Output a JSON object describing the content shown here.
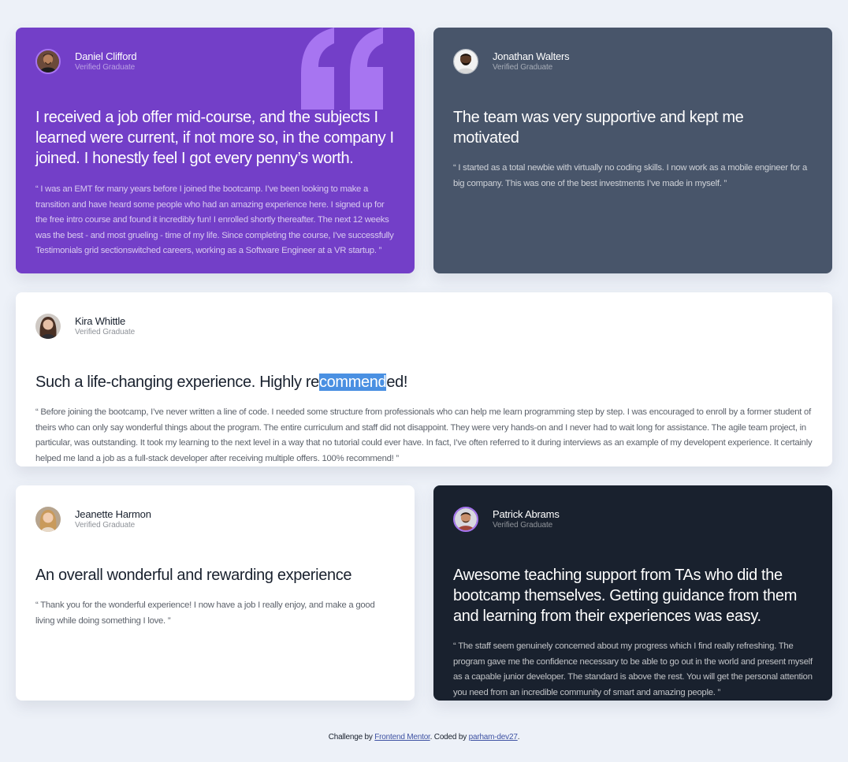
{
  "colors": {
    "page_background": "#edf1f8",
    "purple": "#733fc8",
    "grayish_blue": "#48556a",
    "white": "#ffffff",
    "dark_blackish_blue": "#19212e",
    "quote_mark": "#a775f1",
    "selection": "#4a90e2",
    "link": "#3e52a3"
  },
  "testimonials": {
    "daniel": {
      "name": "Daniel Clifford",
      "status": "Verified Graduate",
      "headline": "I received a job offer mid-course, and the subjects I learned were current, if not more so, in the company I joined. I honestly feel I got every penny’s worth.",
      "body": "“ I was an EMT for many years before I joined the bootcamp. I’ve been looking to make a transition and have heard some people who had an amazing experience here. I signed up for the free intro course and found it incredibly fun! I enrolled shortly thereafter. The next 12 weeks was the best - and most grueling - time of my life. Since completing the course, I’ve successfully Testimonials grid sectionswitched careers, working as a Software Engineer at a VR startup. ”",
      "icon": "quote-icon"
    },
    "jonathan": {
      "name": "Jonathan Walters",
      "status": "Verified Graduate",
      "headline": "The team was very supportive and kept me motivated",
      "body": "“ I started as a total newbie with virtually no coding skills. I now work as a mobile engineer for a big company. This was one of the best investments I’ve made in myself. ”"
    },
    "kira": {
      "name": "Kira Whittle",
      "status": "Verified Graduate",
      "headline_before": "Such a life-changing experience. Highly re",
      "headline_selected": "commend",
      "headline_after": "ed!",
      "body": "“ Before joining the bootcamp, I’ve never written a line of code. I needed some structure from professionals who can help me learn programming step by step. I was encouraged to enroll by a former student of theirs who can only say wonderful things about the program. The entire curriculum and staff did not disappoint. They were very hands-on and I never had to wait long for assistance. The agile team project, in particular, was outstanding. It took my learning to the next level in a way that no tutorial could ever have. In fact, I’ve often referred to it during interviews as an example of my developent experience. It certainly helped me land a job as a full-stack developer after receiving multiple offers. 100% recommend! ”"
    },
    "jeanette": {
      "name": "Jeanette Harmon",
      "status": "Verified Graduate",
      "headline": "An overall wonderful and rewarding experience",
      "body": "“ Thank you for the wonderful experience! I now have a job I really enjoy, and make a good living while doing something I love. ”"
    },
    "patrick": {
      "name": "Patrick Abrams",
      "status": "Verified Graduate",
      "headline": "Awesome teaching support from TAs who did the bootcamp themselves. Getting guidance from them and learning from their experiences was easy.",
      "body": "“ The staff seem genuinely concerned about my progress which I find really refreshing. The program gave me the confidence necessary to be able to go out in the world and present myself as a capable junior developer. The standard is above the rest. You will get the personal attention you need from an incredible community of smart and amazing people. ”"
    }
  },
  "footer": {
    "prefix": "Challenge by ",
    "link1": "Frontend Mentor",
    "middle": ". Coded by ",
    "link2": "parham-dev27",
    "suffix": "."
  }
}
